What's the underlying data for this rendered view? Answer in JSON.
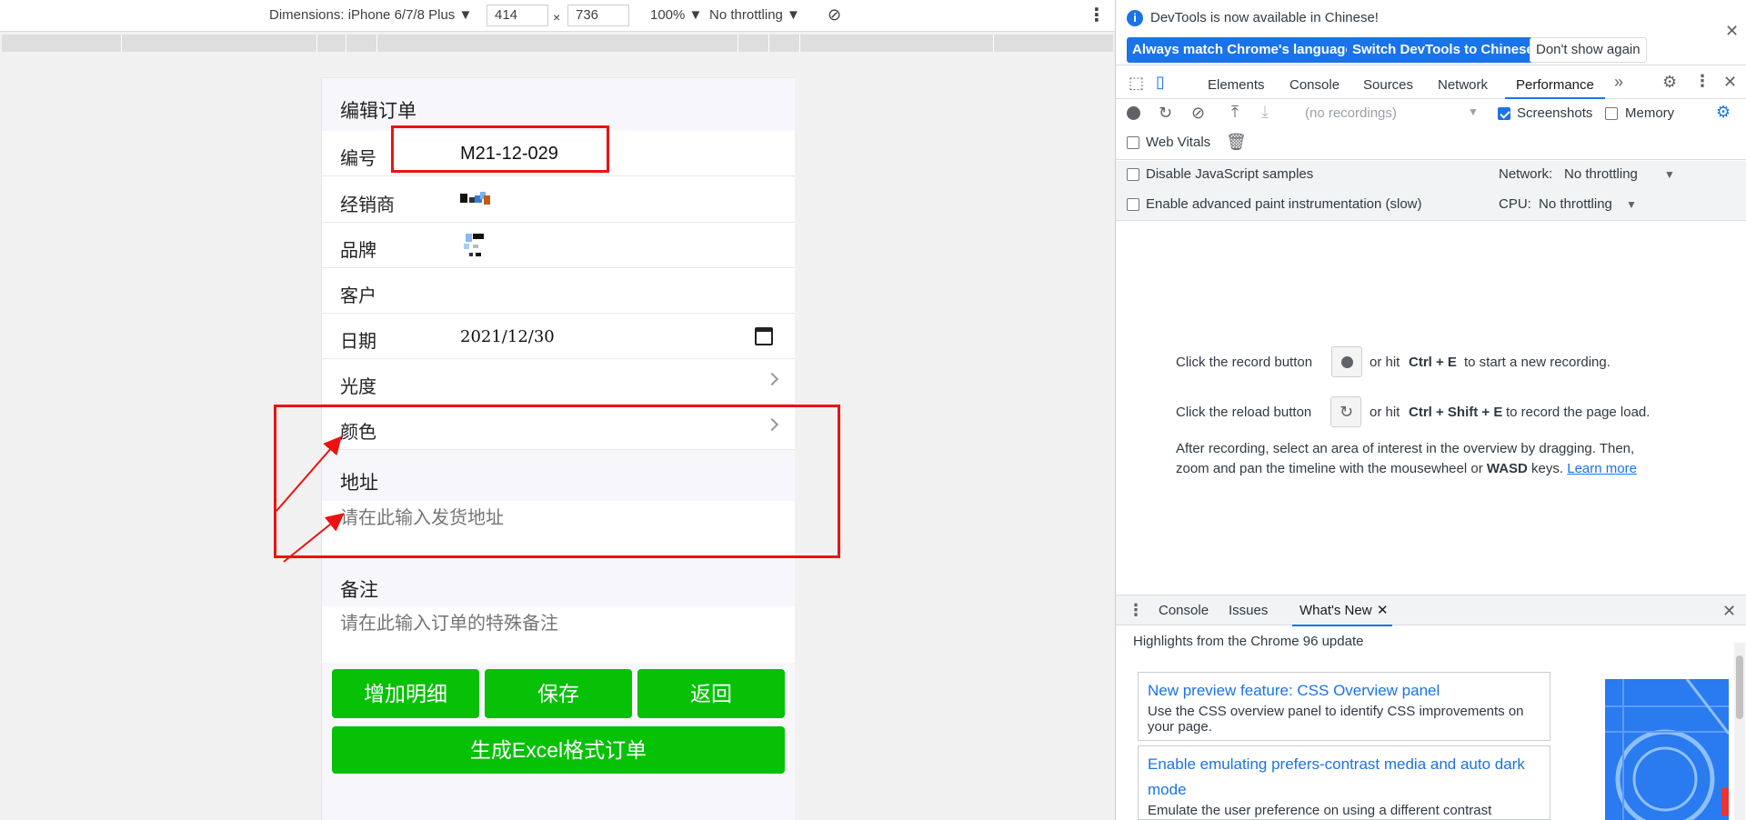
{
  "emulator": {
    "device_label": "Dimensions: iPhone 6/7/8 Plus",
    "width": "414",
    "height": "736",
    "times": "×",
    "zoom": "100%",
    "throttle": "No throttling"
  },
  "phone": {
    "header": "编辑订单",
    "rows": {
      "number_label": "编号",
      "number_value": "M21-12-029",
      "dealer_label": "经销商",
      "brand_label": "品牌",
      "customer_label": "客户",
      "date_label": "日期",
      "date_value": "2021/12/30",
      "gloss_label": "光度",
      "color_label": "颜色"
    },
    "address": {
      "title": "地址",
      "placeholder": "请在此输入发货地址"
    },
    "remark": {
      "title": "备注",
      "placeholder": "请在此输入订单的特殊备注"
    },
    "buttons": {
      "add_detail": "增加明细",
      "save": "保存",
      "back": "返回",
      "excel": "生成Excel格式订单"
    }
  },
  "devtools": {
    "info_text": "DevTools is now available in Chinese!",
    "btn_match": "Always match Chrome's language",
    "btn_switch": "Switch DevTools to Chinese",
    "btn_dont": "Don't show again",
    "tabs": [
      "Elements",
      "Console",
      "Sources",
      "Network",
      "Performance"
    ],
    "perf": {
      "recordings": "(no recordings)",
      "screenshots": "Screenshots",
      "memory": "Memory",
      "web_vitals": "Web Vitals",
      "disable_js": "Disable JavaScript samples",
      "adv_paint": "Enable advanced paint instrumentation (slow)",
      "network_label": "Network:",
      "network_value": "No throttling",
      "cpu_label": "CPU:",
      "cpu_value": "No throttling"
    },
    "hint": {
      "record_pre": "Click the record button",
      "record_post_a": "or hit",
      "record_keys": "Ctrl + E",
      "record_post_b": "to start a new recording.",
      "reload_pre": "Click the reload button",
      "reload_post_a": "or hit",
      "reload_keys": "Ctrl + Shift + E",
      "reload_post_b": "to record the page load.",
      "after_line1": "After recording, select an area of interest in the overview by dragging. Then,",
      "after_line2_a": "zoom and pan the timeline with the mousewheel or",
      "after_line2_keys": "WASD",
      "after_line2_b": "keys.",
      "learn_more": "Learn more"
    },
    "drawer": {
      "tabs": [
        "Console",
        "Issues",
        "What's New"
      ],
      "highlights": "Highlights from the Chrome 96 update",
      "card1_title": "New preview feature: CSS Overview panel",
      "card1_desc": "Use the CSS overview panel to identify CSS improvements on your page.",
      "card2_title": "Enable emulating prefers-contrast media and auto dark mode",
      "card2_desc": "Emulate the user preference on using a different contrast"
    }
  },
  "colors": {
    "green": "#07c107",
    "red": "#ee1111",
    "blue": "#1a73e8"
  }
}
